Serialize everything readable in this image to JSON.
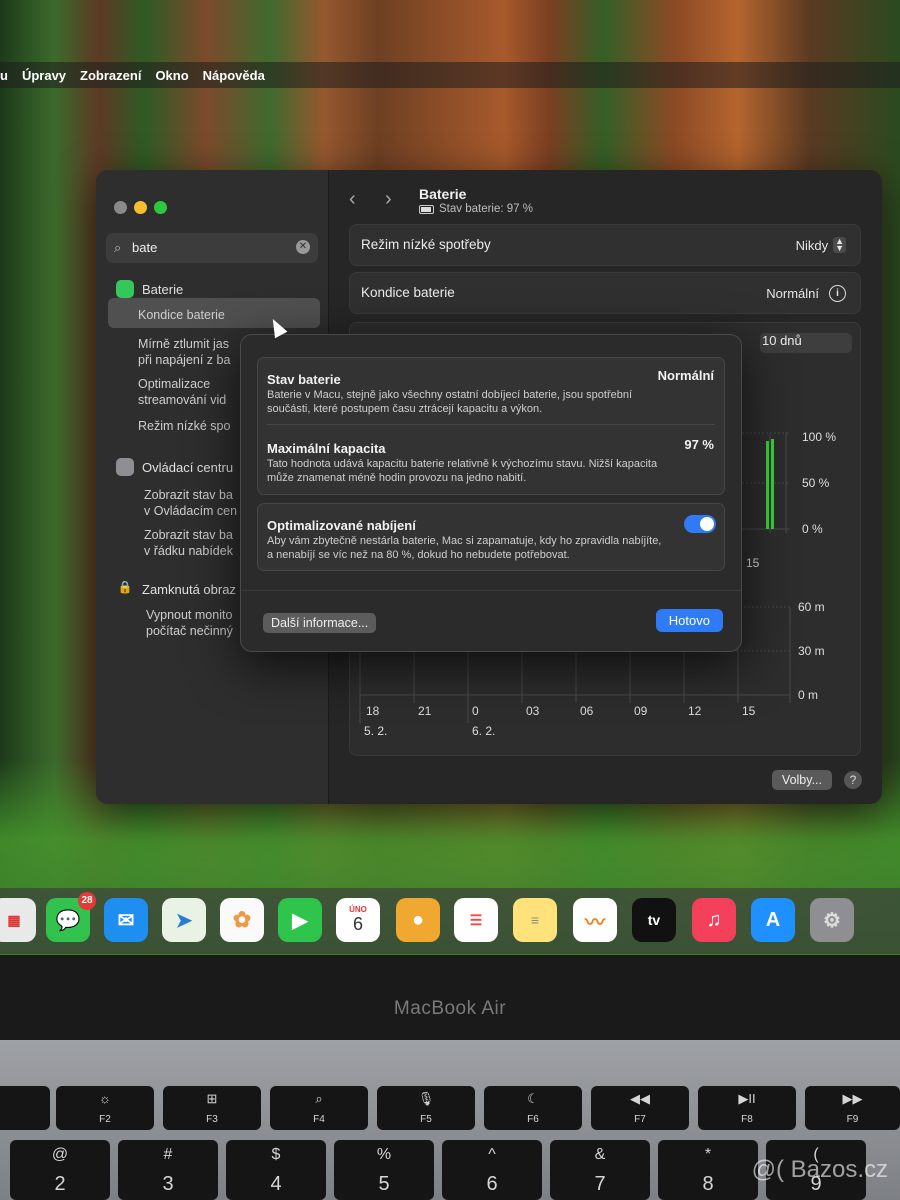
{
  "menubar": {
    "items": [
      "u",
      "Úpravy",
      "Zobrazení",
      "Okno",
      "Nápověda"
    ]
  },
  "search": {
    "value": "bate"
  },
  "sidebar": {
    "group1": {
      "title": "Baterie",
      "items": [
        "Kondice baterie",
        "Mírně ztlumit jas\npři napájení z ba",
        "Optimalizace\nstreamování vid",
        "Režim nízké spo"
      ]
    },
    "group2": {
      "title": "Ovládací centru",
      "items": [
        "Zobrazit stav ba\nv Ovládacím cen",
        "Zobrazit stav ba\nv řádku nabídek"
      ]
    },
    "group3": {
      "title": "Zamknutá obraz",
      "items": [
        "Vypnout monito\npočítač nečinný"
      ]
    }
  },
  "header": {
    "title": "Baterie",
    "status": "Stav baterie: 97 %"
  },
  "rows": {
    "low_power": {
      "label": "Režim nízké spotřeby",
      "value": "Nikdy"
    },
    "health": {
      "label": "Kondice baterie",
      "value": "Normální"
    }
  },
  "chart_data": [
    {
      "type": "bar",
      "yticks": [
        "100 %",
        "50 %",
        "0 %"
      ],
      "xticks": [
        "15"
      ],
      "period": "10 dnů"
    },
    {
      "type": "bar",
      "yticks": [
        "60 m",
        "30 m",
        "0 m"
      ],
      "xticks": [
        "18",
        "21",
        "0",
        "03",
        "06",
        "09",
        "12",
        "15"
      ],
      "dates": [
        "5. 2.",
        "6. 2."
      ]
    }
  ],
  "footer": {
    "options": "Volby...",
    "help": "?"
  },
  "modal": {
    "status": {
      "title": "Stav baterie",
      "value": "Normální",
      "desc": "Baterie v Macu, stejně jako všechny ostatní dobíjecí baterie, jsou spotřební součásti, které postupem času ztrácejí kapacitu a výkon."
    },
    "capacity": {
      "title": "Maximální kapacita",
      "value": "97 %",
      "desc": "Tato hodnota udává kapacitu baterie relativně k výchozímu stavu. Nižší kapacita může znamenat méně hodin provozu na jedno nabití."
    },
    "optimized": {
      "title": "Optimalizované nabíjení",
      "desc": "Aby vám zbytečně nestárla baterie, Mac si zapamatuje, kdy ho zpravidla nabíjíte, a nenabíjí se víc než na 80 %, dokud ho nebudete potřebovat.",
      "enabled": true
    },
    "more_button": "Další informace...",
    "done_button": "Hotovo"
  },
  "dock": {
    "messages_badge": "28",
    "calendar": {
      "month": "ÚNO",
      "day": "6"
    },
    "tv_label": "tv"
  },
  "laptop": {
    "brand": "MacBook Air"
  },
  "keys": {
    "fn": [
      {
        "g": "☼",
        "f": "F2"
      },
      {
        "g": "⊞",
        "f": "F3"
      },
      {
        "g": "⌕",
        "f": "F4"
      },
      {
        "g": "🎙",
        "f": "F5"
      },
      {
        "g": "☾",
        "f": "F6"
      },
      {
        "g": "◀◀",
        "f": "F7"
      },
      {
        "g": "▶II",
        "f": "F8"
      },
      {
        "g": "▶▶",
        "f": "F9"
      }
    ],
    "num": [
      {
        "g": "@",
        "f": "2"
      },
      {
        "g": "#",
        "f": "3"
      },
      {
        "g": "$",
        "f": "4"
      },
      {
        "g": "%",
        "f": "5"
      },
      {
        "g": "^",
        "f": "6"
      },
      {
        "g": "&",
        "f": "7"
      },
      {
        "g": "*",
        "f": "8"
      },
      {
        "g": "(",
        "f": "9"
      }
    ]
  },
  "watermark": "@( Bazos.cz"
}
